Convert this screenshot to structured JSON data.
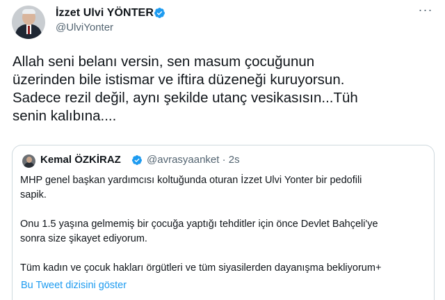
{
  "tweet": {
    "author_name": "İzzet Ulvi YÖNTER",
    "author_handle": "@UlviYonter",
    "text_lines": [
      "Allah seni belanı versin, sen masum çocuğunun",
      "üzerinden bile istismar ve iftira düzeneği kuruyorsun.",
      "Sadece rezil değil, aynı şekilde utanç vesikasısın...Tüh",
      "senin kalıbına...."
    ],
    "more_label": "···"
  },
  "quote": {
    "author_name": "Kemal ÖZKİRAZ",
    "handle_time": "@avrasyaanket · 2s",
    "paragraphs": [
      [
        "MHP genel başkan yardımcısı koltuğunda oturan İzzet Ulvi Yonter bir pedofili",
        "sapik."
      ],
      [
        "Onu 1.5 yaşına gelmemiş bir çocuğa yaptığı tehditler için önce Devlet Bahçeli'ye",
        "sonra size şikayet ediyorum."
      ],
      [
        "Tüm kadın ve çocuk hakları örgütleri ve tüm siyasilerden dayanışma bekliyorum+"
      ]
    ],
    "show_thread_label": "Bu Tweet dizisini göster"
  },
  "colors": {
    "accent": "#1d9bf0",
    "secondary_text": "#536471",
    "border": "#cfd9de"
  },
  "icons": {
    "verified": "verified-badge-icon",
    "more": "more-options-icon"
  }
}
